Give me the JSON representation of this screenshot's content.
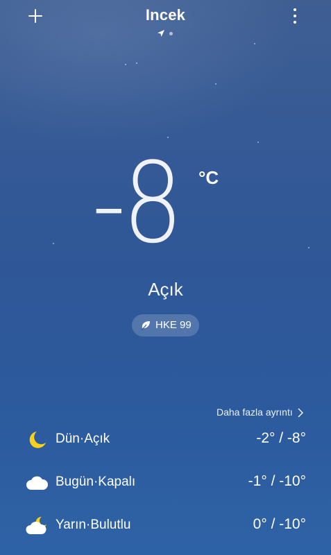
{
  "header": {
    "add_icon": "plus-icon",
    "city": "Incek",
    "location_icon": "navigation-arrow-icon",
    "menu_icon": "more-vertical-icon"
  },
  "current": {
    "temperature": "-8",
    "unit": "°C",
    "condition": "Açık",
    "aqi_icon": "leaf-icon",
    "aqi_label": "HKE 99"
  },
  "details_link": "Daha fazla ayrıntı",
  "forecast": [
    {
      "day": "Dün",
      "sep": "·",
      "condition": "Açık",
      "icon": "moon-icon",
      "range": "-2° / -8°"
    },
    {
      "day": "Bugün",
      "sep": "·",
      "condition": "Kapalı",
      "icon": "cloud-icon",
      "range": "-1° / -10°"
    },
    {
      "day": "Yarın",
      "sep": "·",
      "condition": "Bulutlu",
      "icon": "partly-cloudy-icon",
      "range": "0° / -10°"
    }
  ],
  "colors": {
    "sky_top": "#3f5f93",
    "sky_bottom": "#2e62a6",
    "moon_yellow": "#f6d21b"
  }
}
